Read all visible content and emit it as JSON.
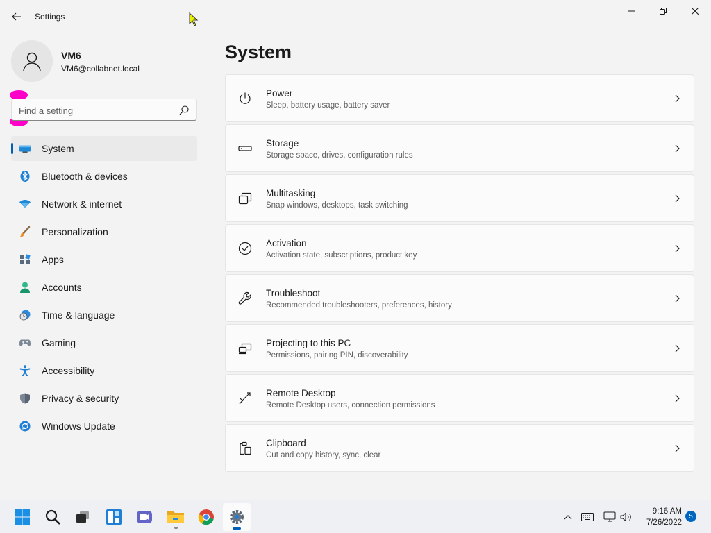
{
  "window": {
    "title": "Settings",
    "back_icon": "back-arrow-icon",
    "controls": [
      "minimize-icon",
      "maximize-icon",
      "close-icon"
    ]
  },
  "profile": {
    "name": "VM6",
    "email": "VM6@collabnet.local",
    "avatar_icon": "user-avatar-icon"
  },
  "search": {
    "placeholder": "Find a setting",
    "value": "",
    "icon": "search-icon"
  },
  "nav": {
    "items": [
      {
        "label": "System",
        "icon": "system-icon",
        "selected": true
      },
      {
        "label": "Bluetooth & devices",
        "icon": "bluetooth-icon"
      },
      {
        "label": "Network & internet",
        "icon": "wifi-icon"
      },
      {
        "label": "Personalization",
        "icon": "brush-icon"
      },
      {
        "label": "Apps",
        "icon": "apps-icon"
      },
      {
        "label": "Accounts",
        "icon": "accounts-icon"
      },
      {
        "label": "Time & language",
        "icon": "time-language-icon"
      },
      {
        "label": "Gaming",
        "icon": "gamepad-icon"
      },
      {
        "label": "Accessibility",
        "icon": "accessibility-icon"
      },
      {
        "label": "Privacy & security",
        "icon": "shield-icon"
      },
      {
        "label": "Windows Update",
        "icon": "windows-update-icon"
      }
    ]
  },
  "main": {
    "title": "System",
    "cards": [
      {
        "title": "Power",
        "subtitle": "Sleep, battery usage, battery saver",
        "icon": "power-icon"
      },
      {
        "title": "Storage",
        "subtitle": "Storage space, drives, configuration rules",
        "icon": "storage-icon"
      },
      {
        "title": "Multitasking",
        "subtitle": "Snap windows, desktops, task switching",
        "icon": "multitasking-icon"
      },
      {
        "title": "Activation",
        "subtitle": "Activation state, subscriptions, product key",
        "icon": "activation-icon"
      },
      {
        "title": "Troubleshoot",
        "subtitle": "Recommended troubleshooters, preferences, history",
        "icon": "wrench-icon"
      },
      {
        "title": "Projecting to this PC",
        "subtitle": "Permissions, pairing PIN, discoverability",
        "icon": "projecting-icon"
      },
      {
        "title": "Remote Desktop",
        "subtitle": "Remote Desktop users, connection permissions",
        "icon": "remote-desktop-icon"
      },
      {
        "title": "Clipboard",
        "subtitle": "Cut and copy history, sync, clear",
        "icon": "clipboard-icon"
      }
    ]
  },
  "taskbar": {
    "apps": [
      "start-icon",
      "search-icon",
      "task-view-icon",
      "widgets-icon",
      "teams-chat-icon",
      "file-explorer-icon",
      "chrome-icon",
      "settings-icon"
    ],
    "tray": [
      "chevron-up-icon",
      "keyboard-icon",
      "network-icon",
      "volume-icon"
    ],
    "time": "9:16 AM",
    "date": "7/26/2022",
    "notification_count": "5"
  },
  "colors": {
    "accent": "#005fb8",
    "background": "#f3f3f3",
    "card": "#fbfbfb",
    "annotation": "#ff00c8"
  }
}
